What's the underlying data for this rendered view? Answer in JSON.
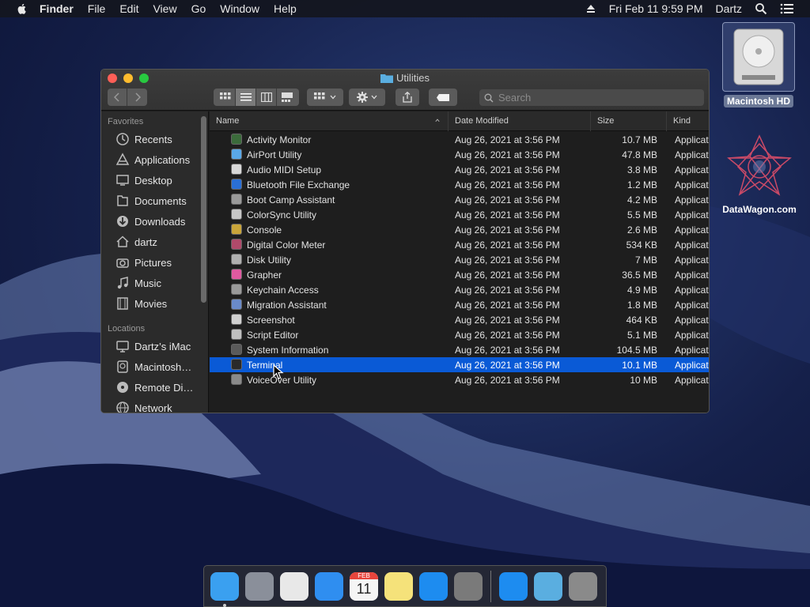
{
  "menubar": {
    "app_name": "Finder",
    "items": [
      "File",
      "Edit",
      "View",
      "Go",
      "Window",
      "Help"
    ],
    "datetime": "Fri Feb 11  9:59 PM",
    "user": "Dartz",
    "icons": [
      "apple-icon",
      "eject-icon",
      "spotlight-icon",
      "notification-center-icon"
    ]
  },
  "desktop": {
    "hd_label": "Macintosh HD",
    "watermark_label": "DataWagon.com"
  },
  "window": {
    "title": "Utilities",
    "search_placeholder": "Search",
    "view_modes": [
      "icon-view",
      "list-view",
      "column-view",
      "gallery-view"
    ],
    "active_view": "list-view"
  },
  "sidebar": {
    "favorites_header": "Favorites",
    "favorites": [
      {
        "label": "Recents",
        "icon": "clock-icon"
      },
      {
        "label": "Applications",
        "icon": "applications-icon"
      },
      {
        "label": "Desktop",
        "icon": "desktop-icon"
      },
      {
        "label": "Documents",
        "icon": "document-icon"
      },
      {
        "label": "Downloads",
        "icon": "download-icon"
      },
      {
        "label": "dartz",
        "icon": "home-icon"
      },
      {
        "label": "Pictures",
        "icon": "camera-icon"
      },
      {
        "label": "Music",
        "icon": "music-icon"
      },
      {
        "label": "Movies",
        "icon": "film-icon"
      }
    ],
    "locations_header": "Locations",
    "locations": [
      {
        "label": "Dartz’s iMac",
        "icon": "imac-icon"
      },
      {
        "label": "Macintosh…",
        "icon": "disk-icon"
      },
      {
        "label": "Remote Di…",
        "icon": "optical-disc-icon"
      },
      {
        "label": "Network",
        "icon": "network-icon"
      }
    ]
  },
  "columns": {
    "name": "Name",
    "date": "Date Modified",
    "size": "Size",
    "kind": "Kind"
  },
  "files": [
    {
      "name": "Activity Monitor",
      "date": "Aug 26, 2021 at 3:56 PM",
      "size": "10.7 MB",
      "kind": "Applicat",
      "color": "#3b6b3b"
    },
    {
      "name": "AirPort Utility",
      "date": "Aug 26, 2021 at 3:56 PM",
      "size": "47.8 MB",
      "kind": "Applicat",
      "color": "#5aa8e8"
    },
    {
      "name": "Audio MIDI Setup",
      "date": "Aug 26, 2021 at 3:56 PM",
      "size": "3.8 MB",
      "kind": "Applicat",
      "color": "#d8d8d8"
    },
    {
      "name": "Bluetooth File Exchange",
      "date": "Aug 26, 2021 at 3:56 PM",
      "size": "1.2 MB",
      "kind": "Applicat",
      "color": "#2a6fd6"
    },
    {
      "name": "Boot Camp Assistant",
      "date": "Aug 26, 2021 at 3:56 PM",
      "size": "4.2 MB",
      "kind": "Applicat",
      "color": "#9a9a9a"
    },
    {
      "name": "ColorSync Utility",
      "date": "Aug 26, 2021 at 3:56 PM",
      "size": "5.5 MB",
      "kind": "Applicat",
      "color": "#c8c8c8"
    },
    {
      "name": "Console",
      "date": "Aug 26, 2021 at 3:56 PM",
      "size": "2.6 MB",
      "kind": "Applicat",
      "color": "#c9a53a"
    },
    {
      "name": "Digital Color Meter",
      "date": "Aug 26, 2021 at 3:56 PM",
      "size": "534 KB",
      "kind": "Applicat",
      "color": "#b04a6a"
    },
    {
      "name": "Disk Utility",
      "date": "Aug 26, 2021 at 3:56 PM",
      "size": "7 MB",
      "kind": "Applicat",
      "color": "#b0b0b0"
    },
    {
      "name": "Grapher",
      "date": "Aug 26, 2021 at 3:56 PM",
      "size": "36.5 MB",
      "kind": "Applicat",
      "color": "#e05aa0"
    },
    {
      "name": "Keychain Access",
      "date": "Aug 26, 2021 at 3:56 PM",
      "size": "4.9 MB",
      "kind": "Applicat",
      "color": "#9a9a9a"
    },
    {
      "name": "Migration Assistant",
      "date": "Aug 26, 2021 at 3:56 PM",
      "size": "1.8 MB",
      "kind": "Applicat",
      "color": "#6a8ac8"
    },
    {
      "name": "Screenshot",
      "date": "Aug 26, 2021 at 3:56 PM",
      "size": "464 KB",
      "kind": "Applicat",
      "color": "#d0d0d0"
    },
    {
      "name": "Script Editor",
      "date": "Aug 26, 2021 at 3:56 PM",
      "size": "5.1 MB",
      "kind": "Applicat",
      "color": "#c0c0c0"
    },
    {
      "name": "System Information",
      "date": "Aug 26, 2021 at 3:56 PM",
      "size": "104.5 MB",
      "kind": "Applicat",
      "color": "#5a5a5a"
    },
    {
      "name": "Terminal",
      "date": "Aug 26, 2021 at 3:56 PM",
      "size": "10.1 MB",
      "kind": "Applicat",
      "color": "#2a2a2a",
      "selected": true
    },
    {
      "name": "VoiceOver Utility",
      "date": "Aug 26, 2021 at 3:56 PM",
      "size": "10 MB",
      "kind": "Applicat",
      "color": "#8a8a8a"
    }
  ],
  "dock": [
    {
      "name": "finder",
      "color": "#3aa0f0",
      "running": true
    },
    {
      "name": "launchpad",
      "color": "#8a8f9a"
    },
    {
      "name": "chrome",
      "color": "#e8e8e8"
    },
    {
      "name": "safari",
      "color": "#2f8ef0"
    },
    {
      "name": "calendar",
      "color": "#f5f5f5",
      "month": "FEB",
      "day": "11"
    },
    {
      "name": "notes",
      "color": "#f5e27a"
    },
    {
      "name": "app-store",
      "color": "#1d8cf0"
    },
    {
      "name": "system-preferences",
      "color": "#7a7a7a"
    },
    {
      "name": "app-store-folder",
      "color": "#1d8cf0"
    },
    {
      "name": "downloads-folder",
      "color": "#5aaee0"
    },
    {
      "name": "trash",
      "color": "#8a8a8a"
    }
  ]
}
